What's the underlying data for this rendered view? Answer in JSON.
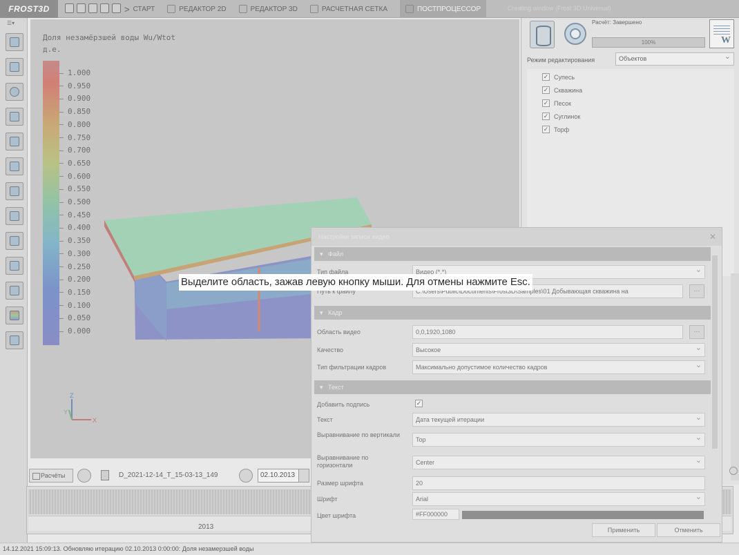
{
  "app": {
    "logo": "FROST3D",
    "window_title": "Creating window (Frost 3D Universal)"
  },
  "menu": {
    "items": [
      {
        "label": "СТАРТ",
        "icon": "play-icon"
      },
      {
        "label": "РЕДАКТОР 2D",
        "icon": "grid-icon"
      },
      {
        "label": "РЕДАКТОР 3D",
        "icon": "cube-icon"
      },
      {
        "label": "РАСЧЕТНАЯ СЕТКА",
        "icon": "mesh-icon"
      },
      {
        "label": "ПОСТПРОЦЕССОР",
        "icon": "chart-icon"
      }
    ]
  },
  "viewport": {
    "legend_title": "Доля незамёрзшей воды Wu/Wtot",
    "legend_units": "д.е.",
    "ticks": [
      "1.000",
      "0.950",
      "0.900",
      "0.850",
      "0.800",
      "0.750",
      "0.700",
      "0.650",
      "0.600",
      "0.550",
      "0.500",
      "0.450",
      "0.400",
      "0.350",
      "0.300",
      "0.250",
      "0.200",
      "0.150",
      "0.100",
      "0.050",
      "0.000"
    ],
    "axis_z": "Z",
    "axis_y": "Y",
    "axis_x": "X"
  },
  "tip": "Выделите область, зажав левую кнопку мыши. Для отмены нажмите Esc.",
  "timebar": {
    "calc_label": "Расчёты",
    "filename": "D_2021-12-14_T_15-03-13_149",
    "date": "02.10.2013",
    "year": "2013"
  },
  "status": "14.12.2021 15:09:13. Обновляю итерацию 02.10.2013 0:00:00: Доля незамерзшей воды",
  "right_panel": {
    "status_label": "Расчёт: Завершено",
    "progress_text": "100%",
    "progress_value": 100,
    "mode_label": "Режим редактирования",
    "mode_value": "Объектов",
    "layers": [
      {
        "label": "Супесь",
        "checked": true
      },
      {
        "label": "Скважина",
        "checked": true
      },
      {
        "label": "Песок",
        "checked": true
      },
      {
        "label": "Суглинок",
        "checked": true
      },
      {
        "label": "Торф",
        "checked": true
      }
    ]
  },
  "dialog": {
    "title": "Настройки записи видео",
    "sections": {
      "file": "Файл",
      "frame": "Кадр",
      "text": "Текст"
    },
    "rows": {
      "file_type_label": "Тип файла",
      "file_type_value": "Видео (*.*)",
      "path_label": "Путь к файлу",
      "path_value": "C:\\Users\\Public\\Documents\\Frost3D\\Samples\\01 Добывающая скважина на",
      "area_label": "Область видео",
      "area_value": "0,0,1920,1080",
      "quality_label": "Качество",
      "quality_value": "Высокое",
      "filter_label": "Тип фильтрации кадров",
      "filter_value": "Максимально допустимое количество кадров",
      "add_caption_label": "Добавить подпись",
      "text_label": "Текст",
      "text_value": "Дата текущей итерации",
      "valign_label": "Выравнивание по вертикали",
      "valign_value": "Top",
      "halign_label": "Выравнивание по горизонтали",
      "halign_value": "Center",
      "font_size_label": "Размер шрифта",
      "font_size_value": "20",
      "font_label": "Шрифт",
      "font_value": "Arial",
      "font_color_label": "Цвет шрифта",
      "font_color_value": "#FF000000"
    },
    "apply_label": "Применить",
    "cancel_label": "Отменить"
  }
}
